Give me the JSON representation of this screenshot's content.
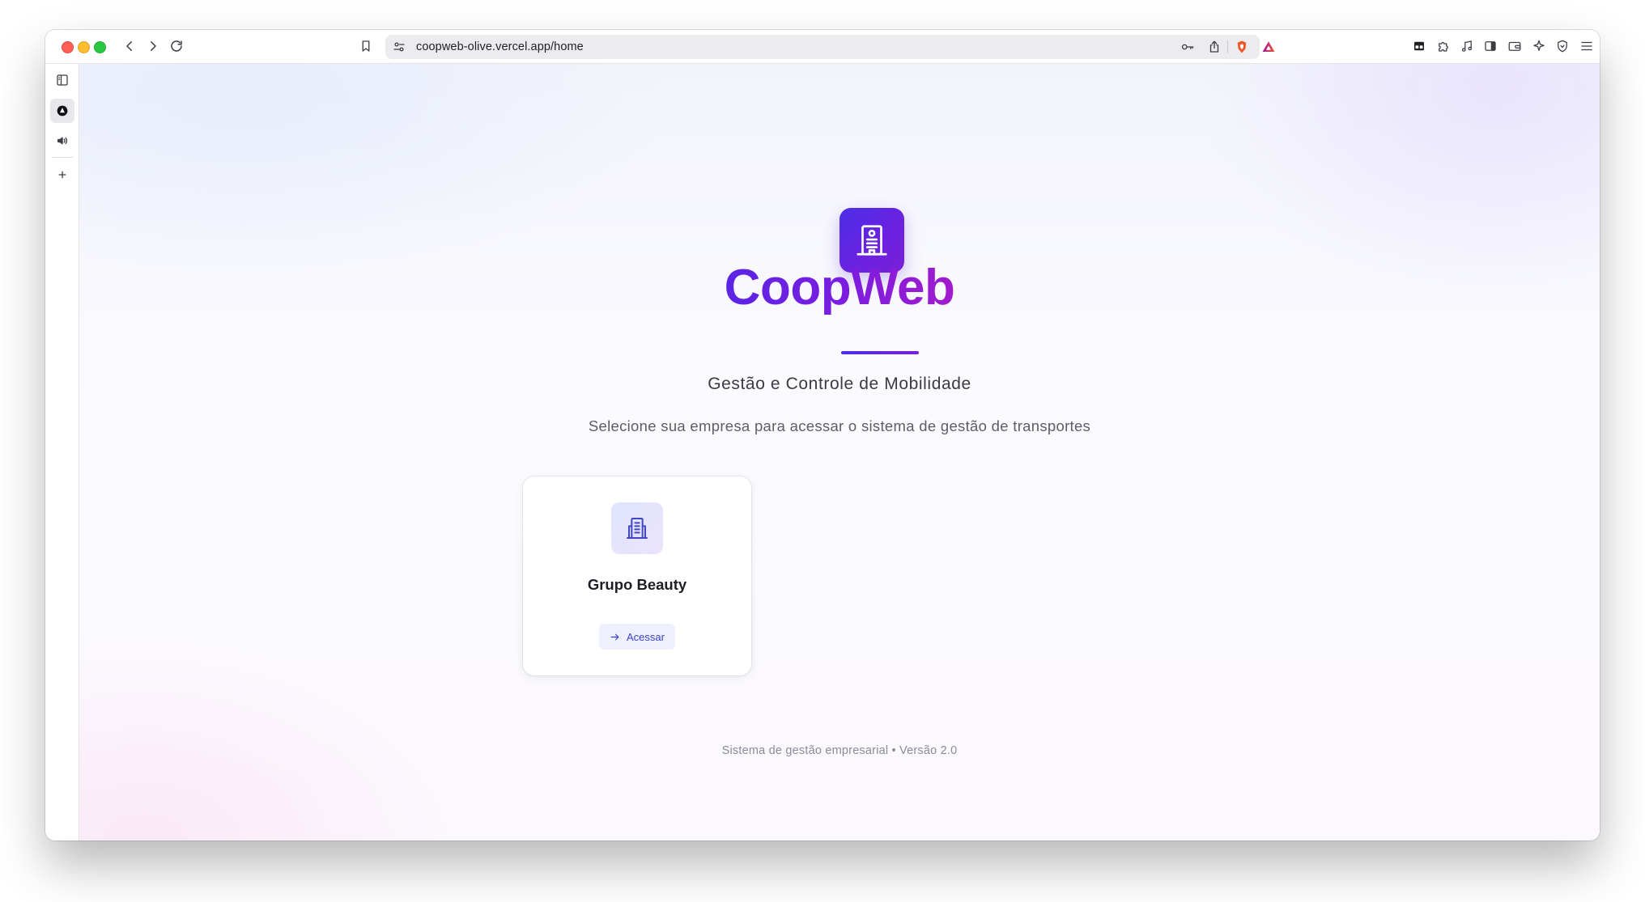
{
  "browser": {
    "url": "coopweb-olive.vercel.app/home",
    "icons": {
      "back": "chevron-left-icon",
      "forward": "chevron-right-icon",
      "reload": "reload-icon",
      "bookmark": "bookmark-icon",
      "site_settings": "site-settings-icon",
      "password_key": "key-icon",
      "share": "share-icon",
      "brave_shields": "brave-shield-icon",
      "brave_rewards": "triangle-icon",
      "extensions_right": [
        "wallet-card-icon",
        "puzzle-icon",
        "music-note-icon",
        "sidebar-panel-icon",
        "wallet-icon",
        "sparkle-icon",
        "vpn-shield-icon",
        "hamburger-menu-icon"
      ]
    }
  },
  "sidebar": {
    "items": [
      "sidebar-toggle-icon",
      "brave-news-icon",
      "speaker-icon",
      "plus-icon"
    ]
  },
  "app": {
    "brand_name": "CoopWeb",
    "tagline": "Gestão e Controle de Mobilidade",
    "subtitle": "Selecione sua empresa para acessar o sistema de gestão de transportes",
    "companies": [
      {
        "name": "Grupo Beauty",
        "action_label": "Acessar"
      }
    ],
    "footer": "Sistema de gestão empresarial • Versão 2.0",
    "colors": {
      "brand_start": "#4a2ee8",
      "brand_end": "#a21bcc",
      "button_text": "#3b3fc9",
      "button_bg": "#eef1fd"
    }
  }
}
